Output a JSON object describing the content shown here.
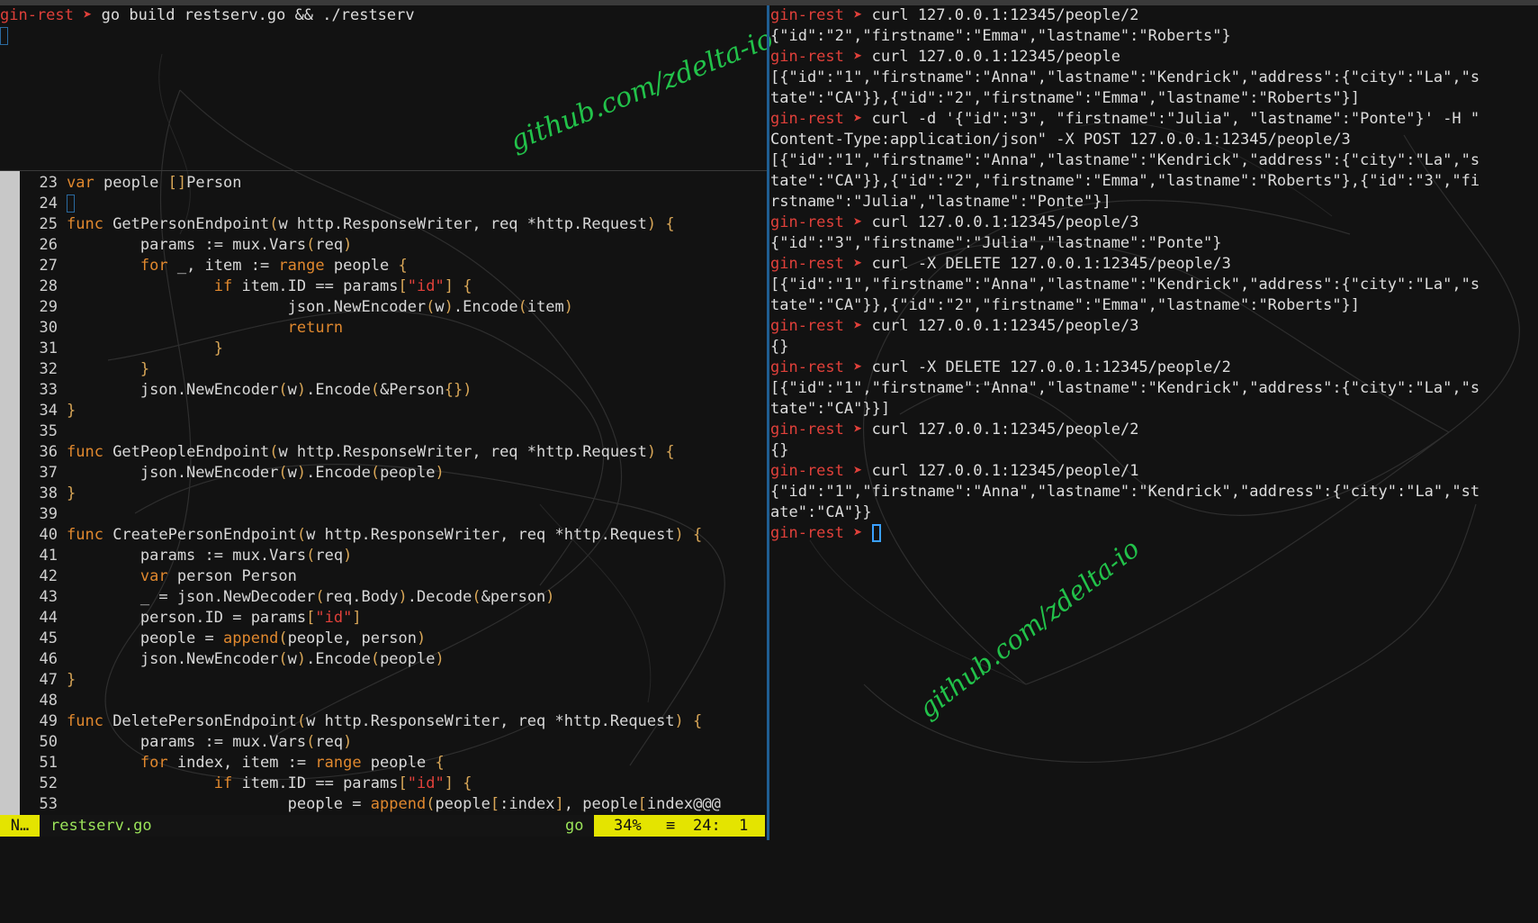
{
  "colors": {
    "prompt": "#e0403a",
    "keyword": "#e0882e",
    "string": "#e0403a",
    "statusbar_accent": "#e4e400",
    "filename": "#9be45a",
    "watermark": "#22c24a",
    "pane_divider": "#1f5e93"
  },
  "watermark_text": "github.com/zdelta-io",
  "top_terminal": {
    "prompt": "gin-rest",
    "arrow": "➤",
    "command": "go build restserv.go && ./restserv"
  },
  "editor": {
    "lines": [
      {
        "n": "23",
        "text": "var people []Person"
      },
      {
        "n": "24",
        "text": ""
      },
      {
        "n": "25",
        "text": "func GetPersonEndpoint(w http.ResponseWriter, req *http.Request) {"
      },
      {
        "n": "26",
        "text": "        params := mux.Vars(req)"
      },
      {
        "n": "27",
        "text": "        for _, item := range people {"
      },
      {
        "n": "28",
        "text": "                if item.ID == params[\"id\"] {"
      },
      {
        "n": "29",
        "text": "                        json.NewEncoder(w).Encode(item)"
      },
      {
        "n": "30",
        "text": "                        return"
      },
      {
        "n": "31",
        "text": "                }"
      },
      {
        "n": "32",
        "text": "        }"
      },
      {
        "n": "33",
        "text": "        json.NewEncoder(w).Encode(&Person{})"
      },
      {
        "n": "34",
        "text": "}"
      },
      {
        "n": "35",
        "text": ""
      },
      {
        "n": "36",
        "text": "func GetPeopleEndpoint(w http.ResponseWriter, req *http.Request) {"
      },
      {
        "n": "37",
        "text": "        json.NewEncoder(w).Encode(people)"
      },
      {
        "n": "38",
        "text": "}"
      },
      {
        "n": "39",
        "text": ""
      },
      {
        "n": "40",
        "text": "func CreatePersonEndpoint(w http.ResponseWriter, req *http.Request) {"
      },
      {
        "n": "41",
        "text": "        params := mux.Vars(req)"
      },
      {
        "n": "42",
        "text": "        var person Person"
      },
      {
        "n": "43",
        "text": "        _ = json.NewDecoder(req.Body).Decode(&person)"
      },
      {
        "n": "44",
        "text": "        person.ID = params[\"id\"]"
      },
      {
        "n": "45",
        "text": "        people = append(people, person)"
      },
      {
        "n": "46",
        "text": "        json.NewEncoder(w).Encode(people)"
      },
      {
        "n": "47",
        "text": "}"
      },
      {
        "n": "48",
        "text": ""
      },
      {
        "n": "49",
        "text": "func DeletePersonEndpoint(w http.ResponseWriter, req *http.Request) {"
      },
      {
        "n": "50",
        "text": "        params := mux.Vars(req)"
      },
      {
        "n": "51",
        "text": "        for index, item := range people {"
      },
      {
        "n": "52",
        "text": "                if item.ID == params[\"id\"] {"
      },
      {
        "n": "53",
        "text": "                        people = append(people[:index], people[index@@@"
      }
    ]
  },
  "statusbar": {
    "mode": "N…",
    "filename": "restserv.go",
    "filetype": "go",
    "percent": "34%",
    "separator": "≡",
    "position": "24:  1"
  },
  "right_terminal": {
    "lines": [
      {
        "kind": "cmd",
        "prompt": "gin-rest",
        "arrow": "➤",
        "text": "curl 127.0.0.1:12345/people/2"
      },
      {
        "kind": "out",
        "text": "{\"id\":\"2\",\"firstname\":\"Emma\",\"lastname\":\"Roberts\"}"
      },
      {
        "kind": "cmd",
        "prompt": "gin-rest",
        "arrow": "➤",
        "text": "curl 127.0.0.1:12345/people"
      },
      {
        "kind": "out",
        "text": "[{\"id\":\"1\",\"firstname\":\"Anna\",\"lastname\":\"Kendrick\",\"address\":{\"city\":\"La\",\"s"
      },
      {
        "kind": "out",
        "text": "tate\":\"CA\"}},{\"id\":\"2\",\"firstname\":\"Emma\",\"lastname\":\"Roberts\"}]"
      },
      {
        "kind": "cmd",
        "prompt": "gin-rest",
        "arrow": "➤",
        "text": "curl -d '{\"id\":\"3\", \"firstname\":\"Julia\", \"lastname\":\"Ponte\"}' -H \""
      },
      {
        "kind": "out",
        "text": "Content-Type:application/json\" -X POST 127.0.0.1:12345/people/3"
      },
      {
        "kind": "out",
        "text": "[{\"id\":\"1\",\"firstname\":\"Anna\",\"lastname\":\"Kendrick\",\"address\":{\"city\":\"La\",\"s"
      },
      {
        "kind": "out",
        "text": "tate\":\"CA\"}},{\"id\":\"2\",\"firstname\":\"Emma\",\"lastname\":\"Roberts\"},{\"id\":\"3\",\"fi"
      },
      {
        "kind": "out",
        "text": "rstname\":\"Julia\",\"lastname\":\"Ponte\"}]"
      },
      {
        "kind": "cmd",
        "prompt": "gin-rest",
        "arrow": "➤",
        "text": "curl 127.0.0.1:12345/people/3"
      },
      {
        "kind": "out",
        "text": "{\"id\":\"3\",\"firstname\":\"Julia\",\"lastname\":\"Ponte\"}"
      },
      {
        "kind": "cmd",
        "prompt": "gin-rest",
        "arrow": "➤",
        "text": "curl -X DELETE 127.0.0.1:12345/people/3"
      },
      {
        "kind": "out",
        "text": "[{\"id\":\"1\",\"firstname\":\"Anna\",\"lastname\":\"Kendrick\",\"address\":{\"city\":\"La\",\"s"
      },
      {
        "kind": "out",
        "text": "tate\":\"CA\"}},{\"id\":\"2\",\"firstname\":\"Emma\",\"lastname\":\"Roberts\"}]"
      },
      {
        "kind": "cmd",
        "prompt": "gin-rest",
        "arrow": "➤",
        "text": "curl 127.0.0.1:12345/people/3"
      },
      {
        "kind": "out",
        "text": "{}"
      },
      {
        "kind": "cmd",
        "prompt": "gin-rest",
        "arrow": "➤",
        "text": "curl -X DELETE 127.0.0.1:12345/people/2"
      },
      {
        "kind": "out",
        "text": "[{\"id\":\"1\",\"firstname\":\"Anna\",\"lastname\":\"Kendrick\",\"address\":{\"city\":\"La\",\"s"
      },
      {
        "kind": "out",
        "text": "tate\":\"CA\"}}]"
      },
      {
        "kind": "cmd",
        "prompt": "gin-rest",
        "arrow": "➤",
        "text": "curl 127.0.0.1:12345/people/2"
      },
      {
        "kind": "out",
        "text": "{}"
      },
      {
        "kind": "cmd",
        "prompt": "gin-rest",
        "arrow": "➤",
        "text": "curl 127.0.0.1:12345/people/1"
      },
      {
        "kind": "out",
        "text": "{\"id\":\"1\",\"firstname\":\"Anna\",\"lastname\":\"Kendrick\",\"address\":{\"city\":\"La\",\"st"
      },
      {
        "kind": "out",
        "text": "ate\":\"CA\"}}"
      },
      {
        "kind": "prompt",
        "prompt": "gin-rest",
        "arrow": "➤",
        "text": ""
      }
    ]
  }
}
